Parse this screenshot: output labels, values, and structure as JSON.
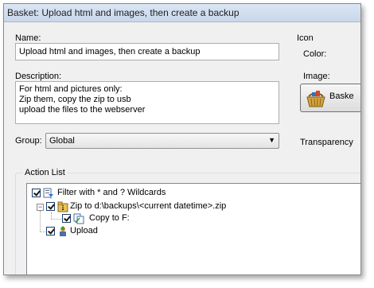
{
  "window": {
    "title": "Basket: Upload html and images, then create a backup"
  },
  "name": {
    "label": "Name:",
    "value": "Upload html and images, then create a backup"
  },
  "description": {
    "label": "Description:",
    "lines": [
      "For html and pictures only:",
      "Zip them, copy the zip to usb",
      "upload the files to the webserver"
    ]
  },
  "group": {
    "label": "Group:",
    "selected": "Global"
  },
  "icon": {
    "label": "Icon",
    "color_label": "Color:",
    "image_label": "Image:",
    "image_button": "Baske",
    "transparency_label": "Transparency"
  },
  "action_list": {
    "label": "Action List",
    "items": [
      {
        "text": "Filter with * and ? Wildcards",
        "icon": "filter-icon",
        "checked": true
      },
      {
        "text": "Zip to d:\\backups\\<current datetime>.zip",
        "icon": "zip-icon",
        "checked": true,
        "expanded": true
      },
      {
        "text": "Copy to F:",
        "icon": "copy-icon",
        "checked": true
      },
      {
        "text": "Upload",
        "icon": "upload-icon",
        "checked": true
      }
    ]
  }
}
